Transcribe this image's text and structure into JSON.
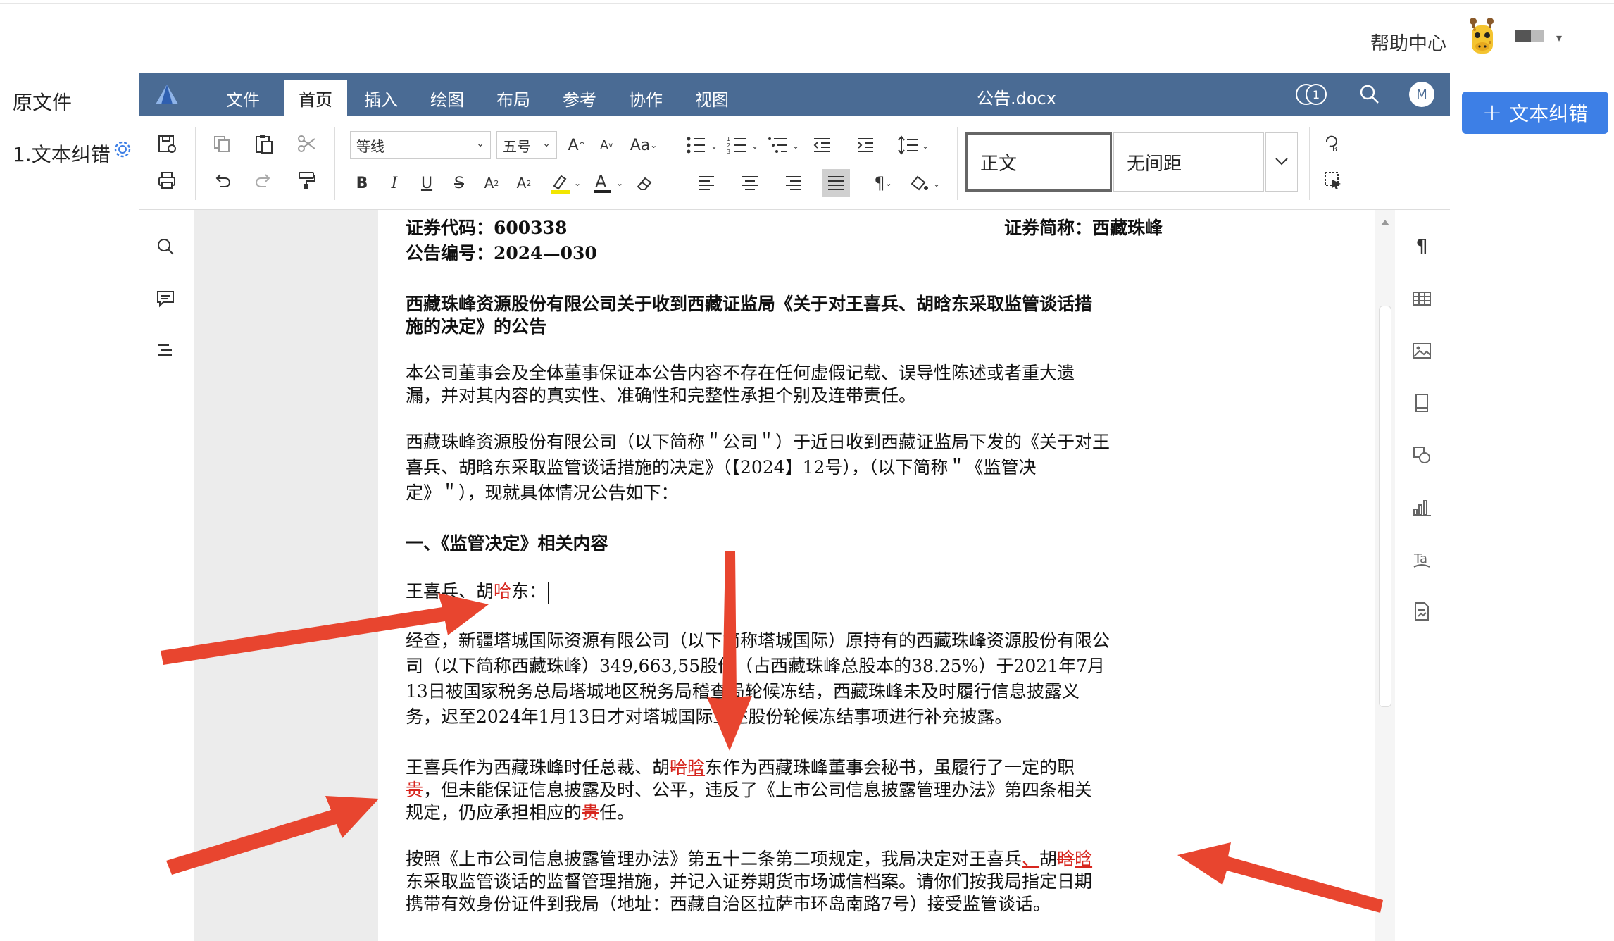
{
  "header": {
    "help_center": "帮助中心"
  },
  "left_panel": {
    "title": "原文件",
    "items": [
      {
        "label": "1.文本纠错"
      }
    ]
  },
  "action_button": {
    "label": "文本纠错"
  },
  "editor": {
    "tabs": [
      "文件",
      "首页",
      "插入",
      "绘图",
      "布局",
      "参考",
      "协作",
      "视图"
    ],
    "active_tab": "首页",
    "document_title": "公告.docx",
    "collab_count": "1",
    "user_initial": "M",
    "font_name": "等线",
    "font_size": "五号",
    "styles": [
      "正文",
      "无间距"
    ],
    "accent_color": "#4a6b94"
  },
  "document": {
    "stock_code": "证券代码：600338",
    "stock_name": "证券简称：西藏珠峰",
    "notice_no": "公告编号：2024—030",
    "title_line1": "西藏珠峰资源股份有限公司关于收到西藏证监局《关于对王喜兵、胡晗东采取监管谈话措",
    "title_line2": "施的决定》的公告",
    "p1_line1": "本公司董事会及全体董事保证本公告内容不存在任何虚假记载、误导性陈述或者重大遗",
    "p1_line2": "漏，并对其内容的真实性、准确性和完整性承担个别及连带责任。",
    "p2_line1": "西藏珠峰资源股份有限公司（以下简称＂公司＂）于近日收到西藏证监局下发的《关于对王",
    "p2_line2": "喜兵、胡晗东采取监管谈话措施的决定》（【2024】12号），（以下简称＂《监管决",
    "p2_line3": "定》＂），现就具体情况公告如下：",
    "section1": "一、《监管决定》相关内容",
    "names_a": "王喜兵、胡",
    "names_err": "哈",
    "names_b": "东：",
    "p3_line1": "经查，新疆塔城国际资源有限公司（以下简称塔城国际）原持有的西藏珠峰资源股份有限公",
    "p3_line2": "司（以下简称西藏珠峰）349,663,55股份（占西藏珠峰总股本的38.25%）于2021年7月",
    "p3_line3": "13日被国家税务总局塔城地区税务局稽查局轮候冻结，西藏珠峰未及时履行信息披露义",
    "p3_line4": "务，迟至2024年1月13日才对塔城国际上述股份轮候冻结事项进行补充披露。",
    "p4_l1_a": "王喜兵作为西藏珠峰时任总裁、胡",
    "p4_l1_del": "哈",
    "p4_l1_ins": "晗",
    "p4_l1_b": "东作为西藏珠峰董事会秘书，虽履行了一定的职",
    "p4_l2_del": "贵",
    "p4_l2_b": "，但未能保证信息披露及时、公平，违反了《上市公司信息披露管理办法》第四条相关",
    "p4_l3_a": "规定，仍应承担相应的",
    "p4_l3_del": "贵",
    "p4_l3_b": "任。",
    "p5_l1_a": "按照《上市公司信息披露管理办法》第五十二条第二项规定，我局决定对王喜兵",
    "p5_l1_ins1": "、",
    "p5_l1_b": "胡",
    "p5_l1_del": "晗",
    "p5_l1_ins2": "晗",
    "p5_line2": "东采取监管谈话的监督管理措施，并记入证券期货市场诚信档案。请你们按我局指定日期",
    "p5_line3": "携带有效身份证件到我局（地址：西藏自治区拉萨市环岛南路7号）接受监管谈话。"
  },
  "colors": {
    "annotation_arrow": "#e8452f",
    "button_blue": "#3d7fe6",
    "revision_red": "#d7261e"
  }
}
